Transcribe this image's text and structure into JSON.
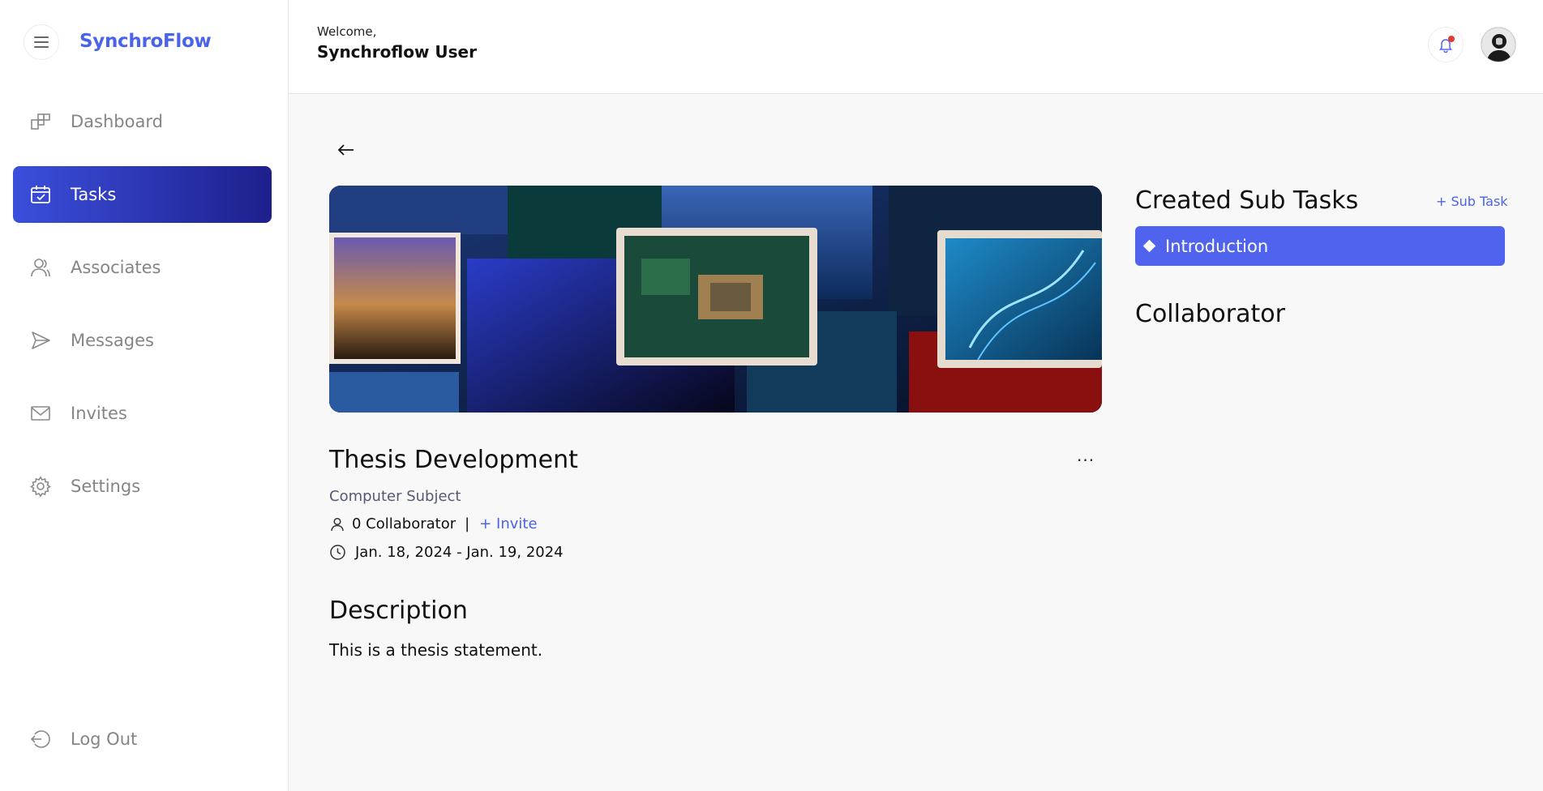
{
  "app": {
    "name": "SynchroFlow"
  },
  "sidebar": {
    "items": [
      {
        "label": "Dashboard",
        "icon": "dashboard-icon",
        "active": false
      },
      {
        "label": "Tasks",
        "icon": "tasks-calendar-icon",
        "active": true
      },
      {
        "label": "Associates",
        "icon": "associates-icon",
        "active": false
      },
      {
        "label": "Messages",
        "icon": "send-icon",
        "active": false
      },
      {
        "label": "Invites",
        "icon": "mail-icon",
        "active": false
      },
      {
        "label": "Settings",
        "icon": "gear-icon",
        "active": false
      }
    ],
    "logout_label": "Log Out"
  },
  "header": {
    "welcome": "Welcome,",
    "username": "Synchroflow User",
    "notification_badge_color": "#e53935"
  },
  "task": {
    "title": "Thesis Development",
    "subject": "Computer Subject",
    "collaborators": "0 Collaborator",
    "separator": "|",
    "invite_label": "+ Invite",
    "date_range": "Jan. 18, 2024 - Jan. 19, 2024",
    "more_label": "···",
    "description_heading": "Description",
    "description": "This is a thesis statement."
  },
  "subtasks": {
    "heading": "Created Sub Tasks",
    "add_label": "+ Sub Task",
    "items": [
      {
        "label": "Introduction"
      }
    ]
  },
  "collaborators_panel": {
    "heading": "Collaborator"
  },
  "colors": {
    "accent": "#4a63e8",
    "active_gradient_start": "#3b4fdc",
    "active_gradient_end": "#1d1f8c",
    "subtask_bg": "#4f63ee"
  }
}
